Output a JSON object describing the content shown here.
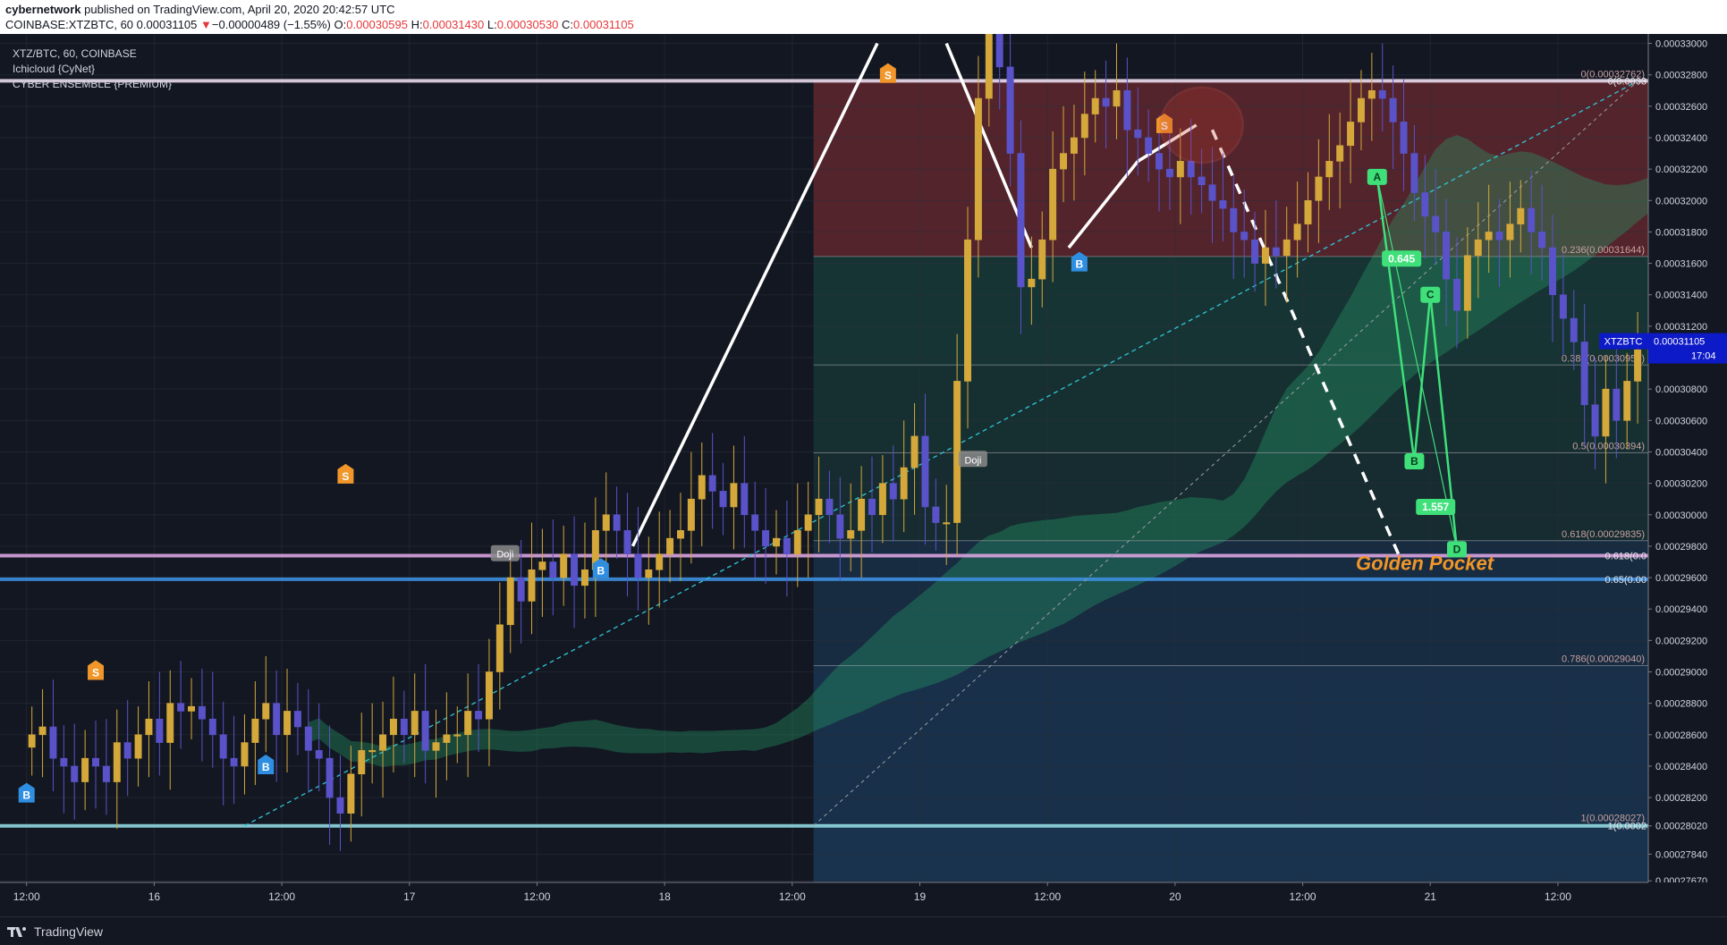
{
  "header": {
    "author": "cybernetwork",
    "published_text": " published on TradingView.com, April 20, 2020 20:42:57 UTC",
    "symbol_line": "COINBASE:XTZBTC, 60",
    "price": "0.00031105",
    "change": "−0.00000489 (−1.55%)",
    "o_label": "O:",
    "o_value": "0.00030595",
    "h_label": "H:",
    "h_value": "0.00031430",
    "l_label": "L:",
    "l_value": "0.00030530",
    "c_label": "C:",
    "c_value": "0.00031105"
  },
  "legend": {
    "symbol": "XTZ/BTC, 60, COINBASE",
    "indicator1": "Ichicloud {CyNet}",
    "indicator2": "CYBER ENSEMBLE {PREMIUM}"
  },
  "footer": {
    "brand": "TradingView"
  },
  "colors": {
    "background": "#131722",
    "up": "#d4a83a",
    "down": "#5a52c9",
    "bull_marker": "#2f8ee0",
    "bear_marker": "#f0962a",
    "fib_zone_red": "#8b2f35",
    "fib_zone_green": "#1f6b5a",
    "fib_zone_blue": "#1f4f7a",
    "golden_pocket": "#f0962a",
    "harmonic": "#3fe07a",
    "price_tag": "#0d1ac7"
  },
  "chart_data": {
    "type": "candlestick",
    "pair": "XTZ/BTC",
    "timeframe": "60",
    "exchange": "COINBASE",
    "ylim": [
      0.0002766,
      0.0003306
    ],
    "y_ticks": [
      "0.00033000",
      "0.00032800",
      "0.00032600",
      "0.00032400",
      "0.00032200",
      "0.00032000",
      "0.00031800",
      "0.00031600",
      "0.00031400",
      "0.00031200",
      "0.00031000",
      "0.00030800",
      "0.00030600",
      "0.00030400",
      "0.00030200",
      "0.00030000",
      "0.00029800",
      "0.00029600",
      "0.00029400",
      "0.00029200",
      "0.00029000",
      "0.00028800",
      "0.00028600",
      "0.00028400",
      "0.00028200",
      "0.00028020",
      "0.00027840",
      "0.00027670"
    ],
    "y_tick_values": [
      0.00033,
      0.000328,
      0.000326,
      0.000324,
      0.000322,
      0.00032,
      0.000318,
      0.000316,
      0.000314,
      0.000312,
      0.00031,
      0.000308,
      0.000306,
      0.000304,
      0.000302,
      0.0003,
      0.000298,
      0.000296,
      0.000294,
      0.000292,
      0.00029,
      0.000288,
      0.000286,
      0.000284,
      0.000282,
      0.0002802,
      0.0002784,
      0.0002767
    ],
    "x_ticks": [
      {
        "label": "12:00",
        "i": -0.5
      },
      {
        "label": "16",
        "i": 11.5
      },
      {
        "label": "12:00",
        "i": 23.5
      },
      {
        "label": "17",
        "i": 35.5
      },
      {
        "label": "12:00",
        "i": 47.5
      },
      {
        "label": "18",
        "i": 59.5
      },
      {
        "label": "12:00",
        "i": 71.5
      },
      {
        "label": "19",
        "i": 83.5
      },
      {
        "label": "12:00",
        "i": 95.5
      },
      {
        "label": "20",
        "i": 107.5
      },
      {
        "label": "12:00",
        "i": 119.5
      },
      {
        "label": "21",
        "i": 131.5
      },
      {
        "label": "12:00",
        "i": 143.5
      }
    ],
    "i_range": [
      -3,
      152
    ],
    "close": [
      0.000286,
      0.0002865,
      0.0002845,
      0.000284,
      0.000283,
      0.0002845,
      0.000284,
      0.000283,
      0.0002855,
      0.0002845,
      0.000286,
      0.000287,
      0.0002855,
      0.000288,
      0.0002875,
      0.0002878,
      0.000287,
      0.000286,
      0.0002845,
      0.000284,
      0.0002855,
      0.000287,
      0.000288,
      0.000286,
      0.0002875,
      0.0002865,
      0.000285,
      0.0002845,
      0.000282,
      0.000281,
      0.0002835,
      0.000285,
      0.000285,
      0.000286,
      0.000287,
      0.000286,
      0.0002875,
      0.000285,
      0.0002855,
      0.000286,
      0.000286,
      0.0002875,
      0.000287,
      0.00029,
      0.000293,
      0.000296,
      0.0002945,
      0.0002965,
      0.000297,
      0.000296,
      0.0002975,
      0.0002955,
      0.0002965,
      0.000299,
      0.0003,
      0.000299,
      0.0002975,
      0.000296,
      0.0002965,
      0.0002975,
      0.0002985,
      0.000299,
      0.000301,
      0.0003025,
      0.0003015,
      0.0003005,
      0.000302,
      0.0003,
      0.000299,
      0.000298,
      0.0002985,
      0.0002975,
      0.000299,
      0.0003,
      0.000301,
      0.0003,
      0.0002985,
      0.000299,
      0.000301,
      0.0003,
      0.000302,
      0.000301,
      0.000303,
      0.000305,
      0.0003005,
      0.0002995,
      0.0002995,
      0.0003085,
      0.0003175,
      0.0003265,
      0.0003308,
      0.0003285,
      0.000323,
      0.0003145,
      0.000315,
      0.0003175,
      0.000322,
      0.000323,
      0.000324,
      0.0003255,
      0.0003265,
      0.000326,
      0.000327,
      0.0003245,
      0.000324,
      0.000323,
      0.000322,
      0.0003215,
      0.0003225,
      0.0003215,
      0.000321,
      0.00032,
      0.0003195,
      0.000318,
      0.0003175,
      0.000316,
      0.000317,
      0.0003165,
      0.0003175,
      0.0003185,
      0.00032,
      0.0003215,
      0.0003225,
      0.0003235,
      0.000325,
      0.0003265,
      0.000327,
      0.0003265,
      0.000325,
      0.000323,
      0.0003205,
      0.000319,
      0.000318,
      0.000315,
      0.000313,
      0.0003165,
      0.0003175,
      0.000318,
      0.0003175,
      0.0003185,
      0.0003195,
      0.000318,
      0.000317,
      0.000314,
      0.0003125,
      0.000311,
      0.000307,
      0.000305,
      0.000308,
      0.000306,
      0.0003085,
      0.0003105
    ],
    "fib_levels": [
      {
        "label": "0(0.00032762)",
        "price": 0.00032762
      },
      {
        "label": "0.236(0.00031644)",
        "price": 0.00031644
      },
      {
        "label": "0.382(0.00030953)",
        "price": 0.00030953
      },
      {
        "label": "0.5(0.00030394)",
        "price": 0.00030394
      },
      {
        "label": "0.618(0.00029835)",
        "price": 0.00029835
      },
      {
        "label": "0.786(0.00029040)",
        "price": 0.0002904
      },
      {
        "label": "1(0.00028027)",
        "price": 0.00028027
      }
    ],
    "fib_i_range": [
      73.5,
      152
    ],
    "horizontal_lines": [
      {
        "label": "0(0.0003",
        "price": 0.00032762,
        "color": "#e8d9ec"
      },
      {
        "label": "0.618(0.0",
        "price": 0.0002974,
        "color": "#d9a3e0"
      },
      {
        "label": "0.65(0.00",
        "price": 0.0002959,
        "color": "#3d8fe0"
      },
      {
        "label": "1(0.0002",
        "price": 0.0002802,
        "color": "#8fd6df"
      }
    ],
    "current_price": {
      "symbol": "XTZBTC",
      "value": "0.00031105",
      "countdown": "17:04",
      "price": 0.00031105
    },
    "annotations": {
      "golden_pocket": "Golden Pocket",
      "doji_labels": [
        "Doji",
        "Doji"
      ],
      "harmonic_points": [
        {
          "label": "A",
          "i": 126.5,
          "price": 0.0003215
        },
        {
          "label": "B",
          "i": 130,
          "price": 0.0003034
        },
        {
          "label": "C",
          "i": 131.5,
          "price": 0.000314
        },
        {
          "label": "D",
          "i": 134,
          "price": 0.0002978
        }
      ],
      "harmonic_ratios": [
        {
          "label": "0.645",
          "i": 128.8,
          "price": 0.0003163
        },
        {
          "label": "1.557",
          "i": 132,
          "price": 0.0003005
        }
      ],
      "markers": [
        {
          "type": "B",
          "i": -0.5,
          "price": 0.0002822
        },
        {
          "type": "B",
          "i": 22,
          "price": 0.000284
        },
        {
          "type": "B",
          "i": 53.5,
          "price": 0.0002965
        },
        {
          "type": "B",
          "i": 98.5,
          "price": 0.000316
        },
        {
          "type": "S",
          "i": 6,
          "price": 0.00029
        },
        {
          "type": "S",
          "i": 29.5,
          "price": 0.0003025
        },
        {
          "type": "S",
          "i": 80.5,
          "price": 0.000328
        },
        {
          "type": "S",
          "i": 106.5,
          "price": 0.0003248
        }
      ]
    }
  }
}
